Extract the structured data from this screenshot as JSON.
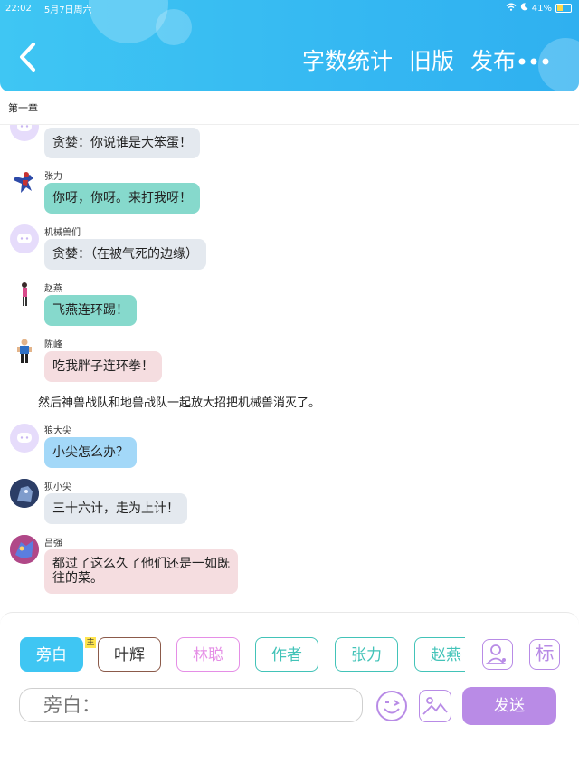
{
  "status_bar": {
    "time": "22:02",
    "date": "5月7日周六",
    "battery": "41%"
  },
  "header": {
    "back_icon": "chevron-left-icon",
    "actions": [
      "字数统计",
      "旧版",
      "发布"
    ],
    "more_icon": "more-dots-icon"
  },
  "chapter": {
    "title": "第一章"
  },
  "messages": [
    {
      "name": "",
      "text": "贪婪：你说谁是大笨蛋！",
      "color": "#e4e9ef"
    },
    {
      "name": "张力",
      "text": "你呀，你呀。来打我呀！",
      "color": "#86d9cc"
    },
    {
      "name": "机械兽们",
      "text": "贪婪：（在被气死的边缘）",
      "color": "#e4e9ef"
    },
    {
      "name": "赵燕",
      "text": "飞燕连环踢！",
      "color": "#86d9cc"
    },
    {
      "name": "陈峰",
      "text": "吃我胖子连环拳！",
      "color": "#f5dde0"
    },
    {
      "name": "狼大尖",
      "text": "小尖怎么办？",
      "color": "#a3d8f8"
    },
    {
      "name": "狈小尖",
      "text": "三十六计，走为上计！",
      "color": "#e4e9ef"
    },
    {
      "name": "吕强",
      "text_line1": "都过了这么久了他们还是一如既",
      "text_line2": "往的菜。",
      "color": "#f5dde0"
    }
  ],
  "narration": "然后神兽战队和地兽战队一起放大招把机械兽消灭了。",
  "roles": [
    {
      "label": "旁白",
      "color": "#3fc6f3",
      "active": true
    },
    {
      "label": "叶辉",
      "color": "#8b5a4a",
      "badge": "主"
    },
    {
      "label": "林聪",
      "color": "#e58ee6"
    },
    {
      "label": "作者",
      "color": "#42c3b8"
    },
    {
      "label": "张力",
      "color": "#42c3b8"
    },
    {
      "label": "赵燕",
      "color": "#42c3b8"
    }
  ],
  "toolbar": {
    "add_role_icon": "person-add-icon",
    "tag_label": "标",
    "input_placeholder": "旁白：",
    "emoji_icon": "emoji-icon",
    "image_icon": "image-icon",
    "send_label": "发送"
  },
  "colors": {
    "header": "#35b8f2",
    "accent_purple": "#b98be6"
  }
}
